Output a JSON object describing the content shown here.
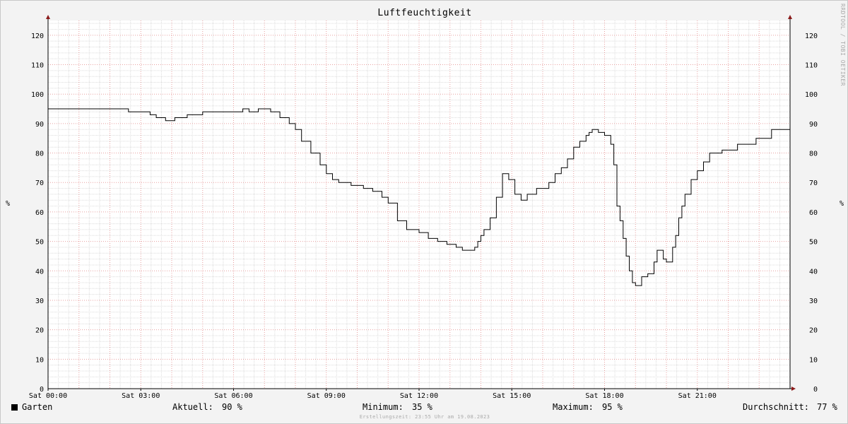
{
  "chart_data": {
    "type": "line",
    "title": "Luftfeuchtigkeit",
    "ylabel": "%",
    "ylim": [
      0,
      125
    ],
    "yticks": [
      0,
      10,
      20,
      30,
      40,
      50,
      60,
      70,
      80,
      90,
      100,
      110,
      120
    ],
    "xlim": [
      0,
      24
    ],
    "xticks": [
      {
        "hour": 0,
        "label": "Sat 00:00"
      },
      {
        "hour": 3,
        "label": "Sat 03:00"
      },
      {
        "hour": 6,
        "label": "Sat 06:00"
      },
      {
        "hour": 9,
        "label": "Sat 09:00"
      },
      {
        "hour": 12,
        "label": "Sat 12:00"
      },
      {
        "hour": 15,
        "label": "Sat 15:00"
      },
      {
        "hour": 18,
        "label": "Sat 18:00"
      },
      {
        "hour": 21,
        "label": "Sat 21:00"
      }
    ],
    "grid": true,
    "series": [
      {
        "name": "Garten",
        "color": "#000000",
        "x": [
          0,
          1.8,
          2.6,
          3.0,
          3.3,
          3.5,
          3.8,
          4.1,
          4.5,
          5.0,
          6.0,
          6.3,
          6.5,
          6.8,
          7.0,
          7.2,
          7.5,
          7.8,
          8.0,
          8.2,
          8.5,
          8.8,
          9.0,
          9.2,
          9.4,
          9.5,
          9.8,
          10.0,
          10.2,
          10.5,
          10.8,
          11.0,
          11.3,
          11.6,
          12.0,
          12.3,
          12.6,
          12.9,
          13.2,
          13.4,
          13.6,
          13.8,
          13.9,
          14.0,
          14.1,
          14.3,
          14.5,
          14.7,
          14.9,
          15.1,
          15.3,
          15.5,
          15.8,
          16.0,
          16.2,
          16.4,
          16.6,
          16.8,
          17.0,
          17.2,
          17.4,
          17.5,
          17.6,
          17.8,
          18.0,
          18.2,
          18.3,
          18.4,
          18.5,
          18.6,
          18.7,
          18.8,
          18.9,
          19.0,
          19.2,
          19.4,
          19.6,
          19.7,
          19.8,
          19.9,
          20.0,
          20.2,
          20.3,
          20.4,
          20.5,
          20.6,
          20.8,
          21.0,
          21.2,
          21.4,
          21.8,
          22.3,
          22.9,
          23.4,
          24.0
        ],
        "values": [
          95,
          95,
          94,
          94,
          93,
          92,
          91,
          92,
          93,
          94,
          94,
          95,
          94,
          95,
          95,
          94,
          92,
          90,
          88,
          84,
          80,
          76,
          73,
          71,
          70,
          70,
          69,
          69,
          68,
          67,
          65,
          63,
          57,
          54,
          53,
          51,
          50,
          49,
          48,
          47,
          47,
          48,
          50,
          52,
          54,
          58,
          65,
          73,
          71,
          66,
          64,
          66,
          68,
          68,
          70,
          73,
          75,
          78,
          82,
          84,
          86,
          87,
          88,
          87,
          86,
          83,
          76,
          62,
          57,
          51,
          45,
          40,
          36,
          35,
          38,
          39,
          43,
          47,
          47,
          44,
          43,
          48,
          52,
          58,
          62,
          66,
          71,
          74,
          77,
          80,
          81,
          83,
          85,
          88,
          90
        ]
      }
    ]
  },
  "watermark": "RRDTOOL / TOBI OETIKER",
  "legend": {
    "series_name": "Garten",
    "current_label": "Aktuell:",
    "current_value": "90 %",
    "min_label": "Minimum:",
    "min_value": "35 %",
    "max_label": "Maximum:",
    "max_value": "95 %",
    "avg_label": "Durchschnitt:",
    "avg_value": "77 %"
  },
  "footer": "Erstellungszeit: 23:55 Uhr am 19.08.2023",
  "colors": {
    "major_grid": "#e8a0a0",
    "minor_grid": "#dcdcdc",
    "axis_arrow": "#8b1a1a",
    "plot_bg": "#ffffff",
    "canvas_bg": "#f3f3f3"
  }
}
